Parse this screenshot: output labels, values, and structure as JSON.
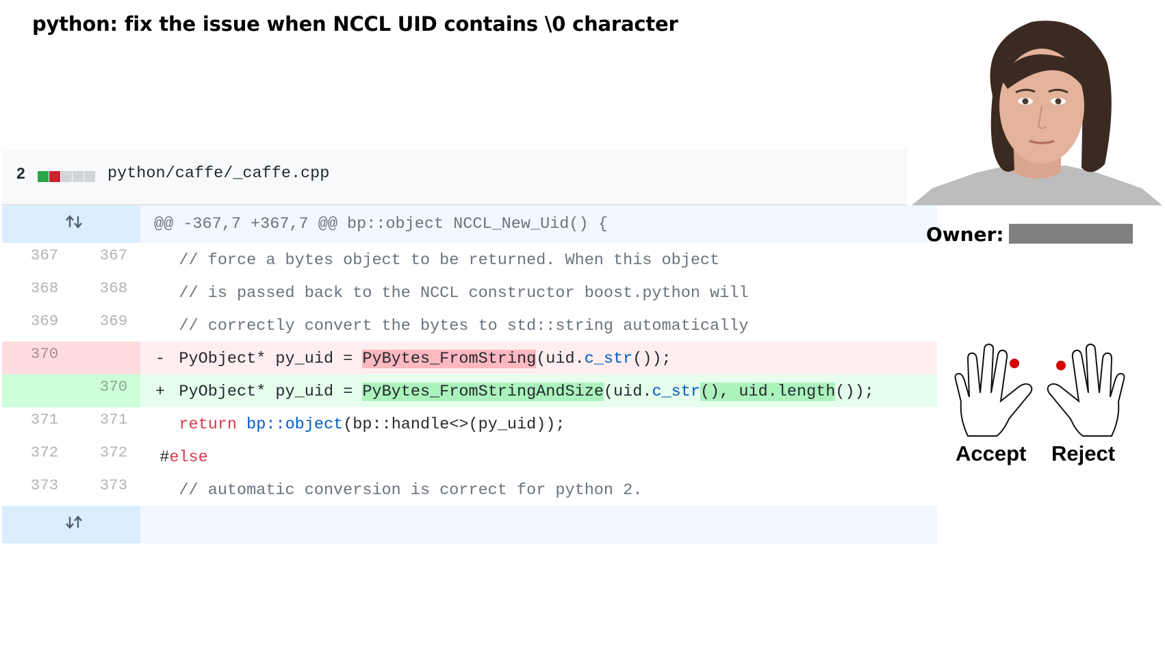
{
  "title": "python: fix the issue when NCCL UID contains \\0 character",
  "file": {
    "changes": "2",
    "path": "python/caffe/_caffe.cpp",
    "diffstat_colors": [
      "#28a745",
      "#cb2431",
      "#d1d5da",
      "#d1d5da",
      "#d1d5da"
    ]
  },
  "hunk_header": "@@ -367,7 +367,7 @@ bp::object NCCL_New_Uid() {",
  "lines": [
    {
      "old": "367",
      "new": "367",
      "marker": "",
      "type": "context",
      "text": "    // force a bytes object to be returned. When this object"
    },
    {
      "old": "368",
      "new": "368",
      "marker": "",
      "type": "context",
      "text": "    // is passed back to the NCCL constructor boost.python will"
    },
    {
      "old": "369",
      "new": "369",
      "marker": "",
      "type": "context",
      "text": "    // correctly convert the bytes to std::string automatically"
    },
    {
      "old": "370",
      "new": "",
      "marker": "-",
      "type": "del",
      "pre": "    PyObject* py_uid = ",
      "hl": "PyBytes_FromString",
      "post1": "(uid.",
      "fn": "c_str",
      "post2": "());"
    },
    {
      "old": "",
      "new": "370",
      "marker": "+",
      "type": "add",
      "pre": "    PyObject* py_uid = ",
      "hl": "PyBytes_FromStringAndSize",
      "post1": "(uid.",
      "fn": "c_str",
      "hl2": "(), uid.length",
      "post2": "());"
    },
    {
      "old": "371",
      "new": "371",
      "marker": "",
      "type": "context",
      "kw": "return",
      "fn": "bp::object",
      "rest": "(bp::handle<>(py_uid));"
    },
    {
      "old": "372",
      "new": "372",
      "marker": "",
      "type": "context",
      "hash": "#",
      "kw2": "else"
    },
    {
      "old": "373",
      "new": "373",
      "marker": "",
      "type": "context",
      "text": "    // automatic conversion is correct for python 2."
    }
  ],
  "owner_label": "Owner:",
  "accept_label": "Accept",
  "reject_label": "Reject",
  "icons": [
    "expand-up-icon",
    "expand-down-icon",
    "left-hand-icon",
    "right-hand-icon"
  ],
  "marker_color": "#d40000"
}
